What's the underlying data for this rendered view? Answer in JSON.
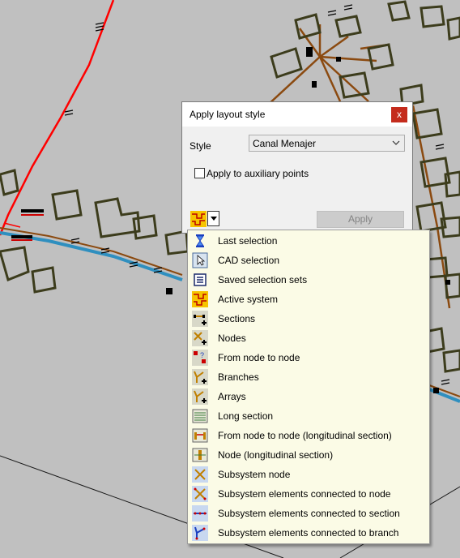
{
  "dialog": {
    "title": "Apply layout style",
    "close_label": "x",
    "style_label": "Style",
    "style_value": "Canal Menajer",
    "aux_points_label": "Apply to auxiliary points",
    "aux_points_checked": false,
    "apply_label": "Apply"
  },
  "selection_menu": {
    "items": [
      {
        "label": "Last selection",
        "icon": "hourglass-icon"
      },
      {
        "label": "CAD selection",
        "icon": "cad-selection-icon"
      },
      {
        "label": "Saved selection sets",
        "icon": "selection-sets-icon"
      },
      {
        "label": "Active system",
        "icon": "active-system-icon"
      },
      {
        "label": "Sections",
        "icon": "sections-icon"
      },
      {
        "label": "Nodes",
        "icon": "nodes-icon"
      },
      {
        "label": "From node to node",
        "icon": "node-to-node-icon"
      },
      {
        "label": "Branches",
        "icon": "branches-icon"
      },
      {
        "label": "Arrays",
        "icon": "arrays-icon"
      },
      {
        "label": "Long section",
        "icon": "long-section-icon"
      },
      {
        "label": "From node to node (longitudinal section)",
        "icon": "node-to-node-longitudinal-icon"
      },
      {
        "label": "Node (longitudinal section)",
        "icon": "node-longitudinal-icon"
      },
      {
        "label": "Subsystem node",
        "icon": "subsystem-node-icon"
      },
      {
        "label": "Subsystem elements connected to node",
        "icon": "subsystem-node-elements-icon"
      },
      {
        "label": "Subsystem elements connected to section",
        "icon": "subsystem-section-elements-icon"
      },
      {
        "label": "Subsystem elements connected to branch",
        "icon": "subsystem-branch-elements-icon"
      }
    ]
  },
  "colors": {
    "canvas_background": "#c0c0c0",
    "menu_background": "#fbfbe6",
    "close_button": "#c42b1c",
    "red_line": "#ff0000",
    "blue_line": "#2f8fbf",
    "brown_line": "#8b4a10",
    "building_outline": "#3c3c1c"
  }
}
